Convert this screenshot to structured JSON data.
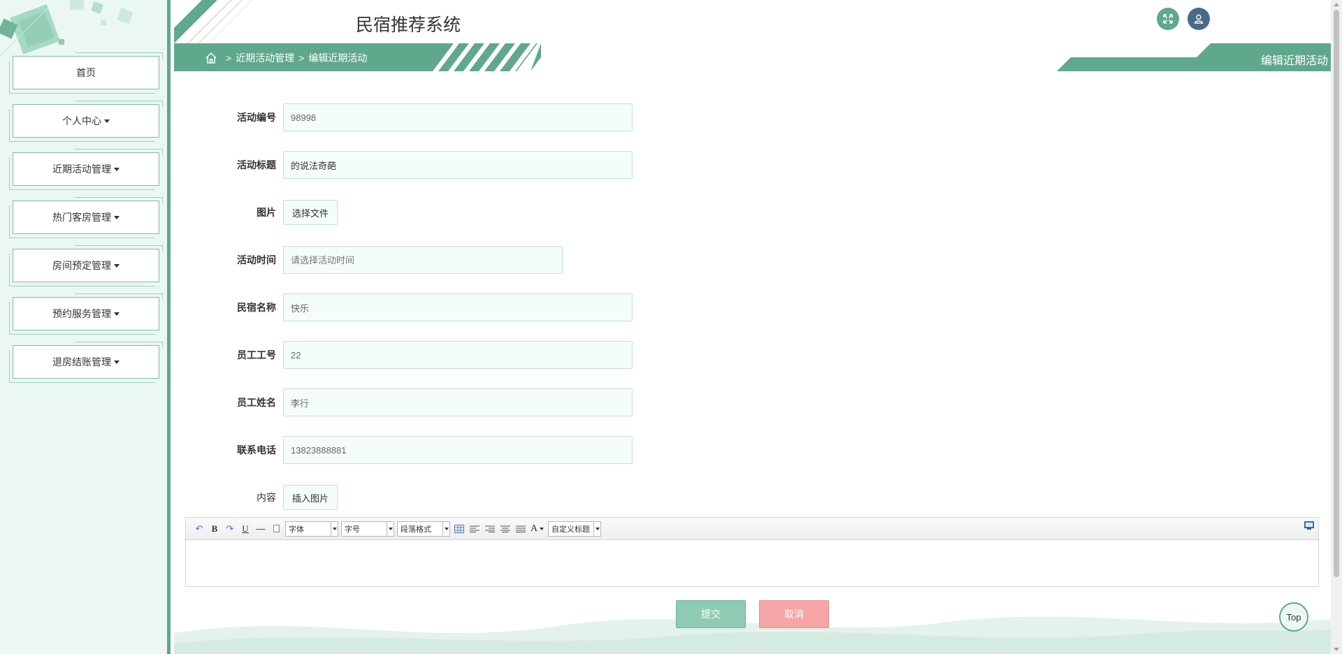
{
  "header": {
    "title": "民宿推荐系统"
  },
  "breadcrumb": {
    "sep": ">",
    "item1": "近期活动管理",
    "item2": "编辑近期活动"
  },
  "page": {
    "title": "编辑近期活动"
  },
  "sidebar": {
    "items": [
      {
        "label": "首页"
      },
      {
        "label": "个人中心"
      },
      {
        "label": "近期活动管理"
      },
      {
        "label": "热门客房管理"
      },
      {
        "label": "房间预定管理"
      },
      {
        "label": "预约服务管理"
      },
      {
        "label": "退房结账管理"
      }
    ]
  },
  "form": {
    "activity_no": {
      "label": "活动编号",
      "value": "98998"
    },
    "activity_title": {
      "label": "活动标题",
      "value": "的说法奇葩"
    },
    "image": {
      "label": "图片",
      "button": "选择文件"
    },
    "activity_time": {
      "label": "活动时间",
      "placeholder": "请选择活动时间"
    },
    "homestay_name": {
      "label": "民宿名称",
      "value": "快乐"
    },
    "staff_no": {
      "label": "员工工号",
      "value": "22"
    },
    "staff_name": {
      "label": "员工姓名",
      "value": "李行"
    },
    "phone": {
      "label": "联系电话",
      "value": "13823888881"
    },
    "content": {
      "label": "内容",
      "button": "插入图片"
    }
  },
  "editor": {
    "font_family": "字体",
    "font_size": "字号",
    "paragraph": "段落格式",
    "custom_title": "自定义标题",
    "bold": "B",
    "underline": "U",
    "font_color": "A"
  },
  "actions": {
    "submit": "提交",
    "cancel": "取消",
    "top": "Top"
  },
  "colors": {
    "primary": "#5fa88c",
    "sidebar_bg": "#ebf7f2",
    "cancel": "#f5a5a5",
    "submit": "#8ecbb2"
  }
}
